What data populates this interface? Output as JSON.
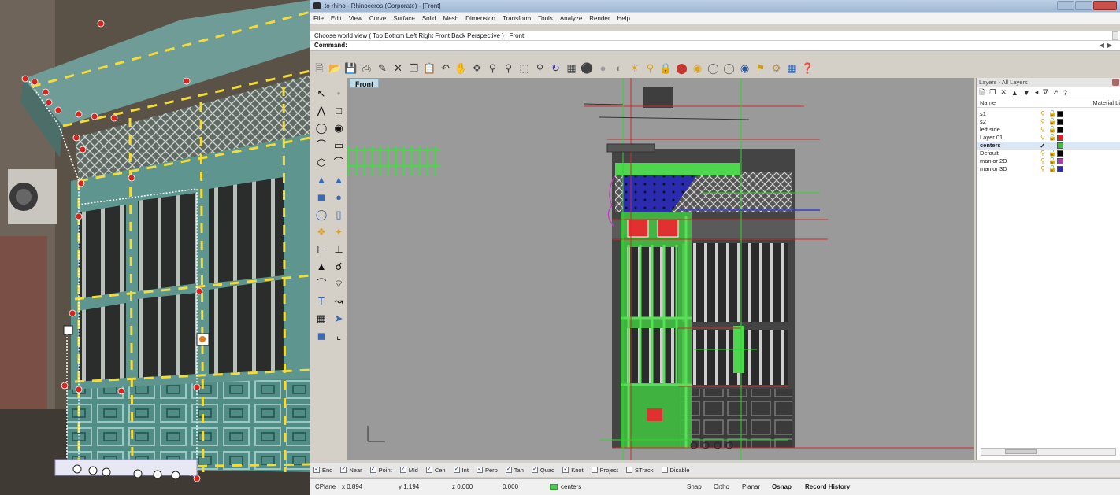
{
  "window": {
    "title": "to rhino - Rhinoceros (Corporate) - [Front]"
  },
  "menu": [
    "File",
    "Edit",
    "View",
    "Curve",
    "Surface",
    "Solid",
    "Mesh",
    "Dimension",
    "Transform",
    "Tools",
    "Analyze",
    "Render",
    "Help"
  ],
  "command": {
    "history": "Choose world view ( Top  Bottom  Left  Right  Front  Back  Perspective ) _Front",
    "prompt": "Command:"
  },
  "viewport": {
    "label": "Front"
  },
  "layers_panel": {
    "title": "Layers - All Layers",
    "columns": {
      "name": "Name",
      "material": "Material Li"
    },
    "layers": [
      {
        "name": "s1",
        "color": "#000000",
        "current": false
      },
      {
        "name": "s2",
        "color": "#000000",
        "current": false
      },
      {
        "name": "left side",
        "color": "#000000",
        "current": false
      },
      {
        "name": "Layer 01",
        "color": "#e02020",
        "current": false
      },
      {
        "name": "centers",
        "color": "#3fbf3f",
        "current": true
      },
      {
        "name": "Default",
        "color": "#000000",
        "current": false
      },
      {
        "name": "manjor 2D",
        "color": "#b03ab0",
        "current": false
      },
      {
        "name": "manjor 3D",
        "color": "#2c2ca8",
        "current": false
      }
    ]
  },
  "osnaps": [
    {
      "label": "End",
      "on": true
    },
    {
      "label": "Near",
      "on": true
    },
    {
      "label": "Point",
      "on": true
    },
    {
      "label": "Mid",
      "on": true
    },
    {
      "label": "Cen",
      "on": true
    },
    {
      "label": "Int",
      "on": true
    },
    {
      "label": "Perp",
      "on": true
    },
    {
      "label": "Tan",
      "on": true
    },
    {
      "label": "Quad",
      "on": true
    },
    {
      "label": "Knot",
      "on": true
    },
    {
      "label": "Project",
      "on": false
    },
    {
      "label": "STrack",
      "on": false
    },
    {
      "label": "Disable",
      "on": false
    }
  ],
  "status": {
    "cplane": "CPlane",
    "x": "x 0.894",
    "y": "y 1.194",
    "z": "z 0.000",
    "d": "0.000",
    "layer": "centers",
    "snap": "Snap",
    "ortho": "Ortho",
    "planar": "Planar",
    "osnap": "Osnap",
    "record": "Record History"
  }
}
